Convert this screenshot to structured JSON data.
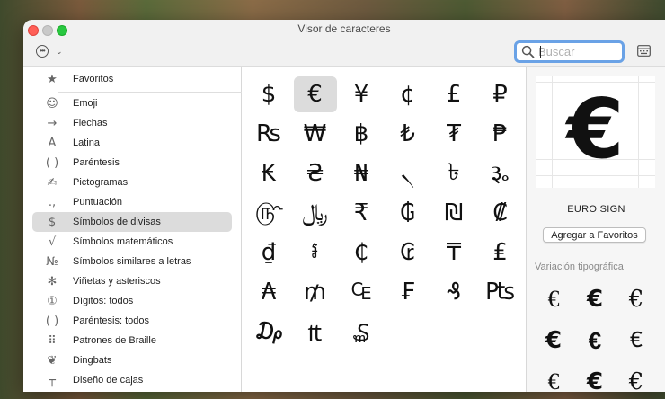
{
  "window": {
    "title": "Visor de caracteres"
  },
  "toolbar": {
    "search_placeholder": "Buscar",
    "action_icon": "ellipsis-circle-icon",
    "keyboard_icon": "keyboard-icon"
  },
  "sidebar": {
    "favorites": {
      "icon": "★",
      "label": "Favoritos"
    },
    "items": [
      {
        "icon": "☺",
        "label": "Emoji"
      },
      {
        "icon": "→",
        "label": "Flechas"
      },
      {
        "icon": "A",
        "label": "Latina"
      },
      {
        "icon": "( )",
        "label": "Paréntesis"
      },
      {
        "icon": "✍",
        "label": "Pictogramas"
      },
      {
        "icon": ".,",
        "label": "Puntuación"
      },
      {
        "icon": "$",
        "label": "Símbolos de divisas"
      },
      {
        "icon": "√",
        "label": "Símbolos matemáticos"
      },
      {
        "icon": "№",
        "label": "Símbolos similares a letras"
      },
      {
        "icon": "✻",
        "label": "Viñetas y asteriscos"
      },
      {
        "icon": "①",
        "label": "Dígitos: todos"
      },
      {
        "icon": "( )",
        "label": "Paréntesis: todos"
      },
      {
        "icon": "⠿",
        "label": "Patrones de Braille"
      },
      {
        "icon": "❦",
        "label": "Dingbats"
      },
      {
        "icon": "┬",
        "label": "Diseño de cajas"
      }
    ],
    "selected_index": 6
  },
  "grid": {
    "glyphs": [
      "$",
      "€",
      "¥",
      "¢",
      "£",
      "₽",
      "₨",
      "₩",
      "฿",
      "₺",
      "₮",
      "₱",
      "₭",
      "₴",
      "₦",
      "৲",
      "৳",
      "૱",
      "௹",
      "﷼",
      "₹",
      "₲",
      "₪",
      "₡",
      "₫",
      "៛",
      "₵",
      "₢",
      "₸",
      "₤",
      "₳",
      "₥",
      "₠",
      "₣",
      "₰",
      "₧",
      "₯",
      "₶",
      "₷"
    ],
    "selected_index": 1
  },
  "detail": {
    "preview_glyph": "€",
    "name": "EURO SIGN",
    "add_favorites_label": "Agregar a Favoritos",
    "variants_heading": "Variación tipográfica",
    "variants": [
      "€",
      "€",
      "€",
      "€",
      "€",
      "€",
      "€",
      "€",
      "€"
    ]
  },
  "colors": {
    "close": "#ff5f57",
    "minimize": "#c9c9c9",
    "maximize": "#28c840",
    "search_focus": "#6aa2e6",
    "selection": "#dcdcdc"
  }
}
